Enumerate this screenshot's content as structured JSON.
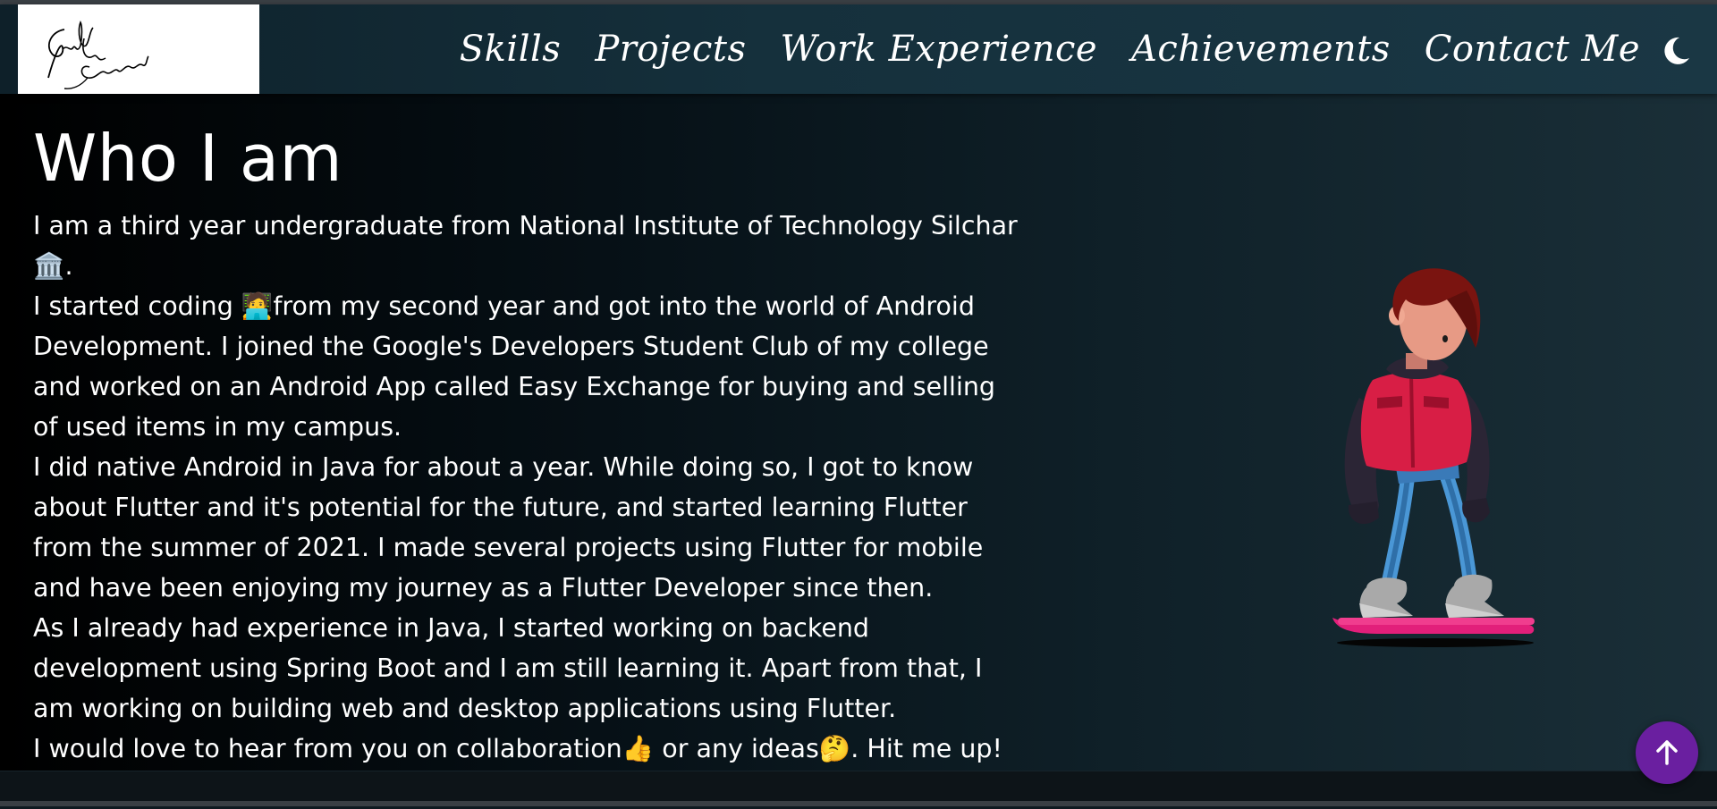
{
  "logo": {
    "alt": "Signature logo"
  },
  "nav": {
    "items": [
      {
        "label": "Skills"
      },
      {
        "label": "Projects"
      },
      {
        "label": "Work Experience"
      },
      {
        "label": "Achievements"
      },
      {
        "label": "Contact Me"
      }
    ],
    "theme_toggle_icon": "moon-icon"
  },
  "about": {
    "title": "Who I am",
    "paragraphs": [
      "I am a third year undergraduate from National Institute of Technology Silchar🏛️.",
      "I started coding 🧑‍💻from my second year and got into the world of Android Development. I joined the Google's Developers Student Club of my college and worked on an Android App called Easy Exchange for buying and selling of used items in my campus.",
      "I did native Android in Java for about a year. While doing so, I got to know about Flutter and it's potential for the future, and started learning Flutter from the summer of 2021. I made several projects using Flutter for mobile and have been enjoying my journey as a Flutter Developer since then.",
      "As I already had experience in Java, I started working on backend development using Spring Boot and I am still learning it. Apart from that, I am working on building web and desktop applications using Flutter.",
      "I would love to hear from you on collaboration👍 or any ideas🤔. Hit me up! 👋"
    ]
  },
  "illustration": {
    "icon": "hoverboard-character-illustration"
  },
  "scroll_top": {
    "icon": "arrow-up-icon"
  },
  "colors": {
    "accent": "#6a1fa0",
    "nav_bg": "#15303c",
    "text": "#ffffff"
  }
}
